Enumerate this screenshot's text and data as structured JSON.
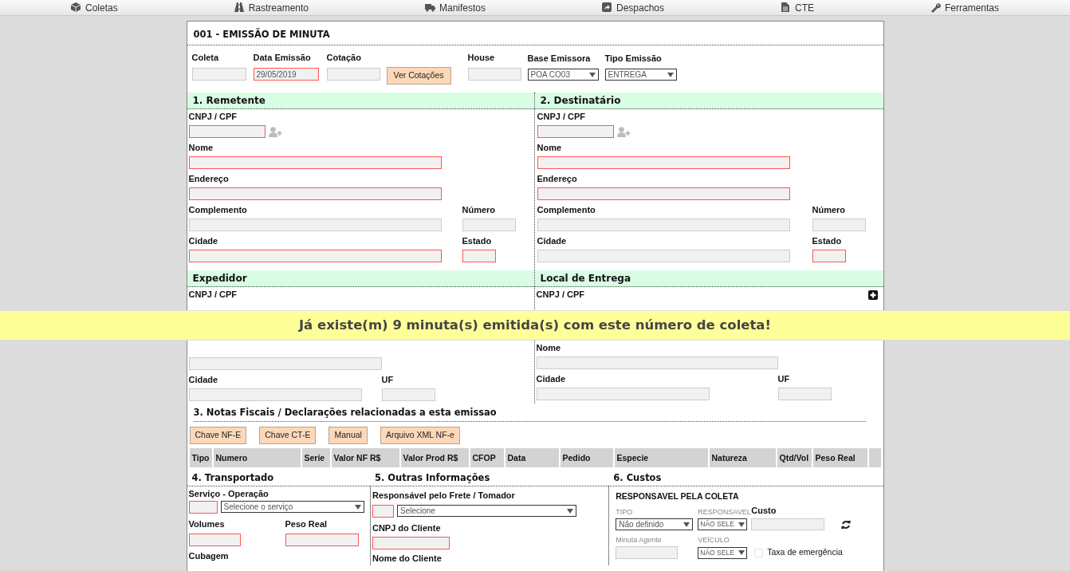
{
  "nav": [
    {
      "label": "Coletas"
    },
    {
      "label": "Rastreamento"
    },
    {
      "label": "Manifestos"
    },
    {
      "label": "Despachos"
    },
    {
      "label": "CTE"
    },
    {
      "label": "Ferramentas"
    }
  ],
  "title": "001 - EMISSÃO DE MINUTA",
  "header_fields": [
    {
      "label": "Coleta",
      "kind": "input",
      "required": false
    },
    {
      "label": "Data Emissão",
      "kind": "input",
      "value": "29/05/2019",
      "required": true
    },
    {
      "label": "Cotação",
      "kind": "input",
      "required": false
    },
    {
      "label": "Ver Cotações",
      "kind": "button"
    },
    {
      "label": "House",
      "kind": "input",
      "required": false
    },
    {
      "label": "Base Emissora",
      "kind": "select",
      "value": "POA CO03"
    },
    {
      "label": "Tipo Emissão",
      "kind": "select",
      "value": "ENTREGA"
    }
  ],
  "parties": [
    {
      "title": "1. Remetente",
      "add_button": false,
      "rows": [
        [
          {
            "label": "CNPJ / CPF",
            "required": true,
            "lookup": true
          }
        ],
        [
          {
            "label": "Nome",
            "required": true
          }
        ],
        [
          {
            "label": "Endereço",
            "required": true
          }
        ],
        [
          {
            "label": "Complemento",
            "required": false
          },
          {
            "label": "Número",
            "required": false
          }
        ],
        [
          {
            "label": "Cidade",
            "required": true
          },
          {
            "label": "Estado",
            "required": true
          }
        ]
      ]
    },
    {
      "title": "2. Destinatário",
      "add_button": false,
      "rows": [
        [
          {
            "label": "CNPJ / CPF",
            "required": true,
            "lookup": true
          }
        ],
        [
          {
            "label": "Nome",
            "required": true
          }
        ],
        [
          {
            "label": "Endereço",
            "required": true
          }
        ],
        [
          {
            "label": "Complemento",
            "required": false
          },
          {
            "label": "Número",
            "required": false
          }
        ],
        [
          {
            "label": "Cidade",
            "required": false
          },
          {
            "label": "Estado",
            "required": true
          }
        ]
      ]
    },
    {
      "title": "Expedidor",
      "add_button": false,
      "rows": [
        [
          {
            "label": "CNPJ / CPF"
          }
        ],
        [
          {
            "required": false
          }
        ],
        [
          {
            "label": "Cidade",
            "required": false
          },
          {
            "label": "UF",
            "required": false
          }
        ]
      ]
    },
    {
      "title": "Local de Entrega",
      "add_button": true,
      "rows": [
        [
          {
            "label": "CNPJ / CPF"
          }
        ],
        [
          {
            "label": "Nome",
            "required": false
          }
        ],
        [
          {
            "label": "Cidade",
            "required": false
          },
          {
            "label": "UF",
            "required": false
          }
        ]
      ]
    }
  ],
  "banner": "Já existe(m) 9 minuta(s) emitida(s) com este número de coleta!",
  "notes": {
    "title": "3. Notas Fiscais / Declarações relacionadas a esta emissao",
    "buttons": [
      "Chave NF-E",
      "Chave CT-E",
      "Manual",
      "Arquivo XML NF-e"
    ],
    "columns": [
      "Tipo",
      "Numero",
      "Serie",
      "Valor NF R$",
      "Valor Prod R$",
      "CFOP",
      "Data",
      "Pedido",
      "Especie",
      "Natureza",
      "Qtd/Vol",
      "Peso Real"
    ]
  },
  "transport": {
    "title": "4. Transportado",
    "service_label": "Serviço - Operação",
    "service_code_required": true,
    "service_select": "Selecione o serviço",
    "volumes_label": "Volumes",
    "volumes_required": true,
    "weight_label": "Peso Real",
    "weight_required": true,
    "cubage_label": "Cubagem"
  },
  "other": {
    "title": "5. Outras Informações",
    "payer_label": "Responsável pelo Frete / Tomador",
    "payer_code_required": true,
    "payer_select": "Selecione",
    "client_cnpj_label": "CNPJ do Cliente",
    "client_cnpj_required": true,
    "client_name_label": "Nome do Cliente"
  },
  "costs": {
    "title": "6. Custos",
    "heading": "RESPONSAVEL PELA COLETA",
    "type_label": "TIPO",
    "type_value": "Não definido",
    "responsible_label": "RESPONSAVEL",
    "responsible_value": "NÃO SELE",
    "cost_label": "Custo",
    "agent_label": "Minuta Agente",
    "vehicle_label": "VEÍCULO",
    "vehicle_value": "NÃO SELE",
    "emergency_label": "Taxa de emergência",
    "emergency_checked": false
  }
}
